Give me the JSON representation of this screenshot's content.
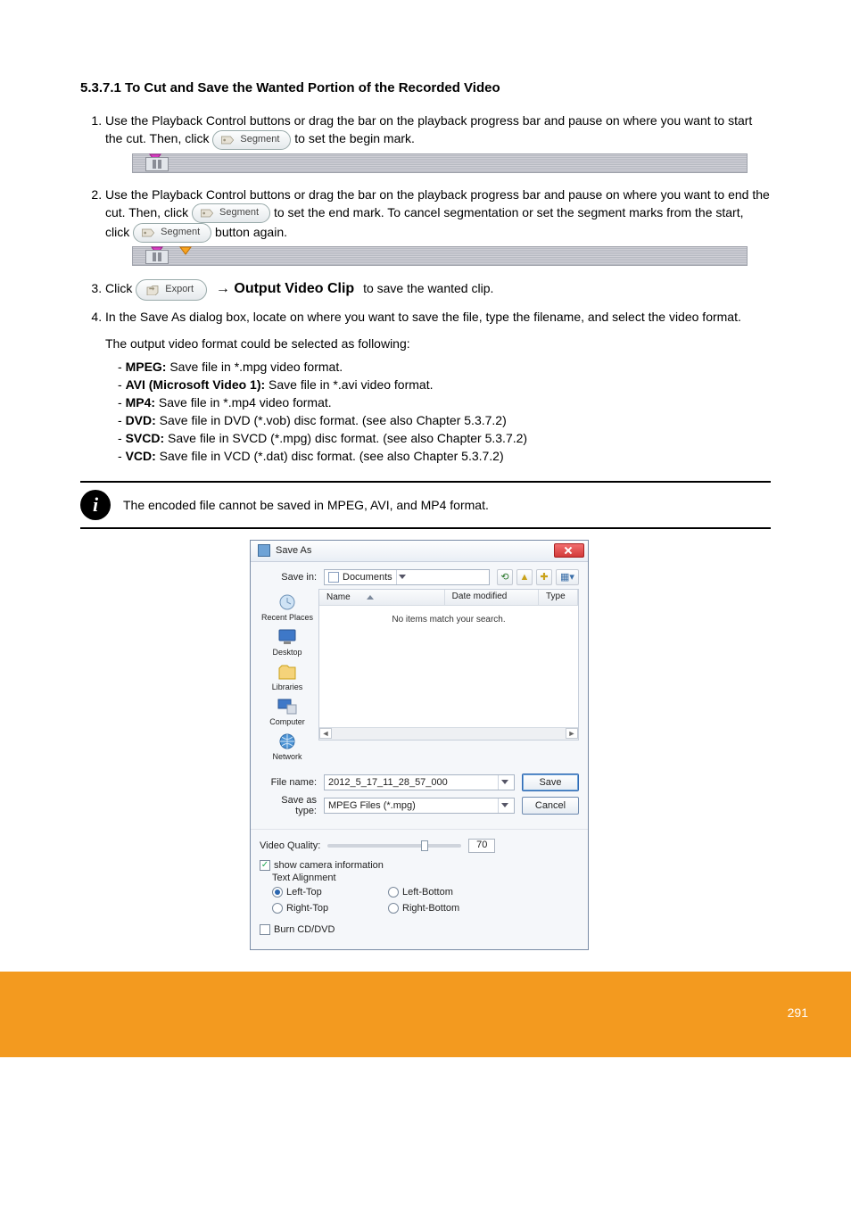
{
  "section": {
    "title": "5.3.7.1 To Cut and Save the Wanted Portion of the Recorded Video"
  },
  "steps": {
    "s1": "Use the Playback Control buttons or drag the bar on the playback progress bar and pause on where you want to start the cut. Then, click ",
    "s1b": " to set the begin mark.",
    "s2": "Use the Playback Control buttons or drag the bar on the playback progress bar and pause on where you want to end the cut. Then, click ",
    "s2b": " to set the end mark. To cancel segmentation or set the segment marks from the start, click ",
    "s2c": " button again.",
    "s3_pre": "Click ",
    "s3_arrow": " → Output Video Clip",
    "s3_post": " to save the wanted clip.",
    "s4": "In the Save As dialog box, locate on where you want to save the file, type the filename, and select the video format."
  },
  "btn": {
    "segment": "Segment",
    "export": "Export"
  },
  "formats": {
    "intro": "The output video format could be selected as following:",
    "mpeg": {
      "title": "MPEG:",
      "desc": " Save file in *.mpg video format."
    },
    "avi": {
      "title": "AVI (Microsoft Video 1):",
      "desc": " Save file in *.avi video format."
    },
    "mp4": {
      "title": "MP4:",
      "desc": " Save file in *.mp4 video format."
    },
    "dvd": {
      "title": "DVD:",
      "desc": " Save file in DVD (*.vob) disc format. (see also Chapter 5.3.7.2)"
    },
    "svcd": {
      "title": "SVCD:",
      "desc": " Save file in SVCD (*.mpg) disc format. (see also Chapter 5.3.7.2)"
    },
    "vcd": {
      "title": "VCD:",
      "desc": " Save file in VCD (*.dat) disc format. (see also Chapter 5.3.7.2)"
    }
  },
  "info_note": "The encoded file cannot be saved in MPEG, AVI, and MP4 format.",
  "dlg": {
    "title": "Save As",
    "save_in_label": "Save in:",
    "save_in_value": "Documents",
    "columns": {
      "name": "Name",
      "date": "Date modified",
      "type": "Type"
    },
    "empty": "No items match your search.",
    "places": {
      "recent": "Recent Places",
      "desktop": "Desktop",
      "libs": "Libraries",
      "comp": "Computer",
      "net": "Network"
    },
    "file_name_label": "File name:",
    "file_name_value": "2012_5_17_11_28_57_000",
    "save_as_type_label": "Save as type:",
    "save_as_type_value": "MPEG Files (*.mpg)",
    "save_btn": "Save",
    "cancel_btn": "Cancel",
    "vq_label": "Video Quality:",
    "vq_value": "70",
    "show_cam": "show camera information",
    "ta_label": "Text Alignment",
    "ta": {
      "lt": "Left-Top",
      "lb": "Left-Bottom",
      "rt": "Right-Top",
      "rb": "Right-Bottom"
    },
    "burn": "Burn  CD/DVD"
  },
  "footer": {
    "page": "291"
  }
}
